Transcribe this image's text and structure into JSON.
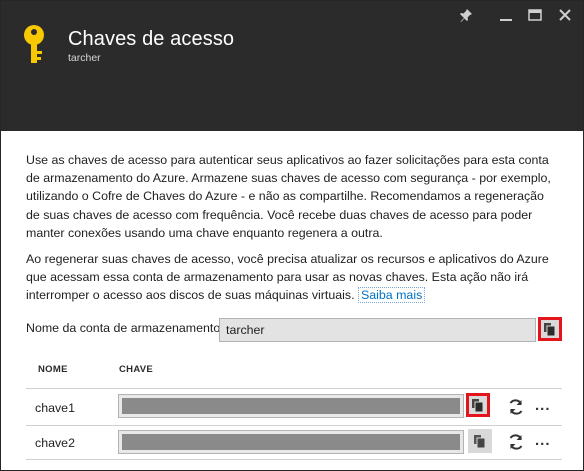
{
  "blade": {
    "title": "Chaves de acesso",
    "subtitle": "tarcher"
  },
  "window_controls": {
    "pin": "pin-icon",
    "minimize": "minimize-icon",
    "maximize": "maximize-icon",
    "close": "close-icon"
  },
  "description": {
    "paragraph1": "Use as chaves de acesso para autenticar seus aplicativos ao fazer solicitações para esta conta de armazenamento do Azure. Armazene suas chaves de acesso com segurança - por exemplo, utilizando o Cofre de Chaves do Azure - e não as compartilhe. Recomendamos a regeneração de suas chaves de acesso com frequência. Você recebe duas chaves de acesso para poder manter conexões usando uma chave enquanto regenera a outra.",
    "paragraph2": "Ao regenerar suas chaves de acesso, você precisa atualizar os recursos e aplicativos do Azure que acessam essa conta de armazenamento para usar as novas chaves. Esta ação não irá interromper o acesso aos discos de suas máquinas virtuais.",
    "learn_more": "Saiba mais"
  },
  "account": {
    "label": "Nome da conta de armazenamento",
    "value": "tarcher"
  },
  "table": {
    "headers": {
      "name": "NOME",
      "key": "CHAVE"
    },
    "rows": [
      {
        "name": "chave1",
        "copy_highlighted": true
      },
      {
        "name": "chave2",
        "copy_highlighted": false
      }
    ],
    "more_label": "..."
  },
  "colors": {
    "header_bg": "#2b2b2b",
    "key_icon": "#f8c800",
    "highlight": "#e3141c",
    "link": "#0072c6"
  }
}
